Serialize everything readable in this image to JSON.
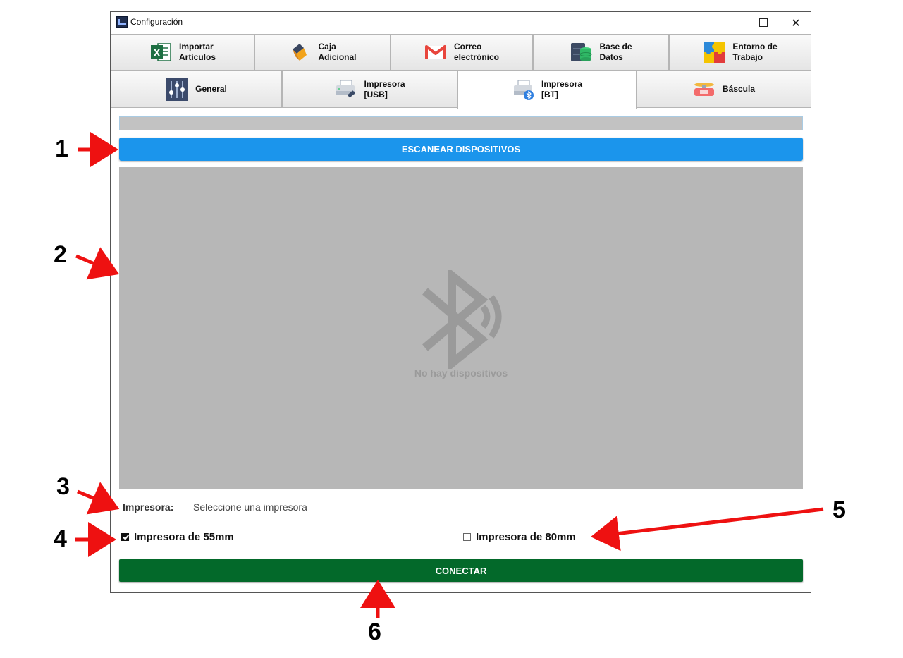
{
  "window": {
    "title": "Configuración"
  },
  "tabs_top": [
    {
      "label": "Importar\nArtículos",
      "icon": "excel-icon"
    },
    {
      "label": "Caja\nAdicional",
      "icon": "cash-box-icon"
    },
    {
      "label": "Correo\nelectrónico",
      "icon": "gmail-icon"
    },
    {
      "label": "Base de\nDatos",
      "icon": "database-icon"
    },
    {
      "label": "Entorno de\nTrabajo",
      "icon": "workspace-puzzle-icon"
    }
  ],
  "tabs_bottom": [
    {
      "label": "General",
      "icon": "sliders-icon"
    },
    {
      "label": "Impresora\n[USB]",
      "icon": "usb-printer-icon"
    },
    {
      "label": "Impresora\n[BT]",
      "icon": "bluetooth-printer-icon",
      "active": true
    },
    {
      "label": "Báscula",
      "icon": "scale-icon"
    }
  ],
  "scan_button": {
    "label": "ESCANEAR DISPOSITIVOS",
    "color": "#1b95ec"
  },
  "device_list": {
    "empty_text": "No hay dispositivos",
    "icon": "bluetooth-icon"
  },
  "printer": {
    "label": "Impresora:",
    "value": "Seleccione una impresora"
  },
  "options": [
    {
      "label": "Impresora de 55mm",
      "checked": true
    },
    {
      "label": "Impresora de 80mm",
      "checked": false
    }
  ],
  "connect_button": {
    "label": "CONECTAR",
    "color": "#03692a"
  },
  "annotations": [
    "1",
    "2",
    "3",
    "4",
    "5",
    "6"
  ]
}
